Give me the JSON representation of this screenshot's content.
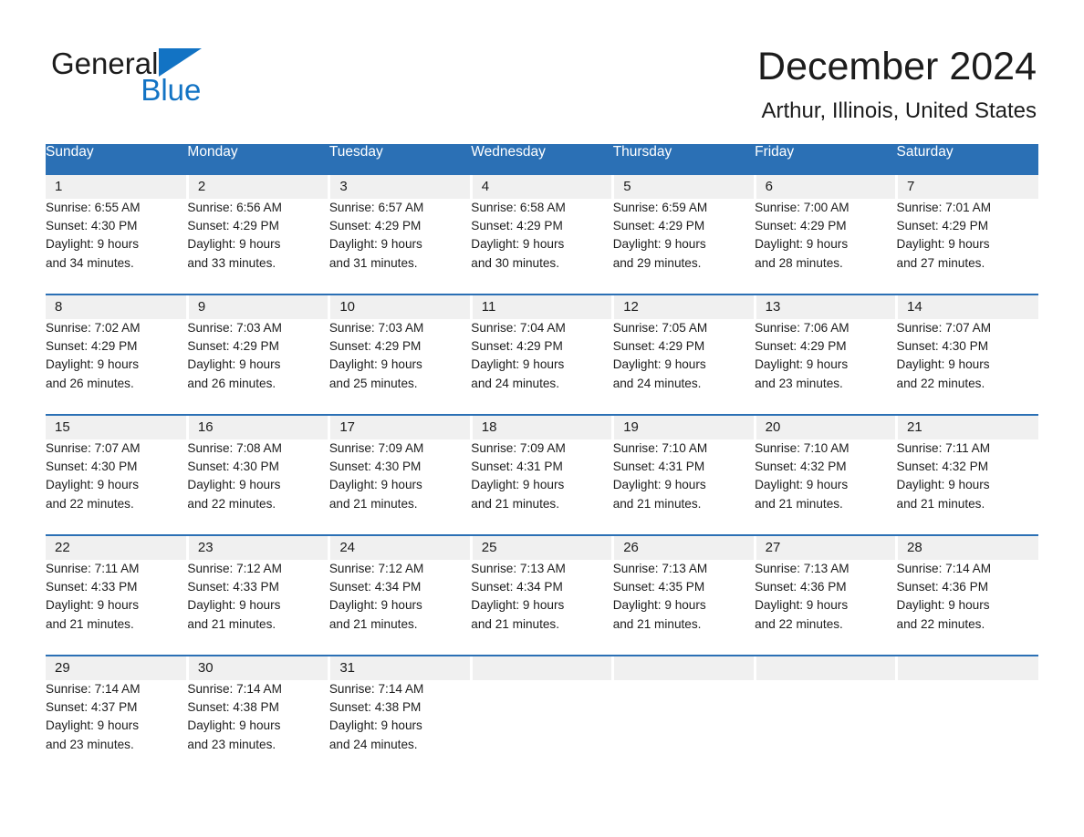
{
  "brand": {
    "name_part1": "General",
    "name_part2": "Blue",
    "triangle_color": "#1273c4",
    "text_color": "#1c1c1c"
  },
  "header": {
    "month_title": "December 2024",
    "location": "Arthur, Illinois, United States"
  },
  "theme": {
    "header_blue": "#2b70b5",
    "daynum_band": "#f0f0f0",
    "text": "#1c1c1c",
    "background": "#ffffff"
  },
  "calendar": {
    "day_headers": [
      "Sunday",
      "Monday",
      "Tuesday",
      "Wednesday",
      "Thursday",
      "Friday",
      "Saturday"
    ],
    "weeks": [
      {
        "days": [
          {
            "date": "1",
            "sunrise": "Sunrise: 6:55 AM",
            "sunset": "Sunset: 4:30 PM",
            "daylight1": "Daylight: 9 hours",
            "daylight2": "and 34 minutes."
          },
          {
            "date": "2",
            "sunrise": "Sunrise: 6:56 AM",
            "sunset": "Sunset: 4:29 PM",
            "daylight1": "Daylight: 9 hours",
            "daylight2": "and 33 minutes."
          },
          {
            "date": "3",
            "sunrise": "Sunrise: 6:57 AM",
            "sunset": "Sunset: 4:29 PM",
            "daylight1": "Daylight: 9 hours",
            "daylight2": "and 31 minutes."
          },
          {
            "date": "4",
            "sunrise": "Sunrise: 6:58 AM",
            "sunset": "Sunset: 4:29 PM",
            "daylight1": "Daylight: 9 hours",
            "daylight2": "and 30 minutes."
          },
          {
            "date": "5",
            "sunrise": "Sunrise: 6:59 AM",
            "sunset": "Sunset: 4:29 PM",
            "daylight1": "Daylight: 9 hours",
            "daylight2": "and 29 minutes."
          },
          {
            "date": "6",
            "sunrise": "Sunrise: 7:00 AM",
            "sunset": "Sunset: 4:29 PM",
            "daylight1": "Daylight: 9 hours",
            "daylight2": "and 28 minutes."
          },
          {
            "date": "7",
            "sunrise": "Sunrise: 7:01 AM",
            "sunset": "Sunset: 4:29 PM",
            "daylight1": "Daylight: 9 hours",
            "daylight2": "and 27 minutes."
          }
        ]
      },
      {
        "days": [
          {
            "date": "8",
            "sunrise": "Sunrise: 7:02 AM",
            "sunset": "Sunset: 4:29 PM",
            "daylight1": "Daylight: 9 hours",
            "daylight2": "and 26 minutes."
          },
          {
            "date": "9",
            "sunrise": "Sunrise: 7:03 AM",
            "sunset": "Sunset: 4:29 PM",
            "daylight1": "Daylight: 9 hours",
            "daylight2": "and 26 minutes."
          },
          {
            "date": "10",
            "sunrise": "Sunrise: 7:03 AM",
            "sunset": "Sunset: 4:29 PM",
            "daylight1": "Daylight: 9 hours",
            "daylight2": "and 25 minutes."
          },
          {
            "date": "11",
            "sunrise": "Sunrise: 7:04 AM",
            "sunset": "Sunset: 4:29 PM",
            "daylight1": "Daylight: 9 hours",
            "daylight2": "and 24 minutes."
          },
          {
            "date": "12",
            "sunrise": "Sunrise: 7:05 AM",
            "sunset": "Sunset: 4:29 PM",
            "daylight1": "Daylight: 9 hours",
            "daylight2": "and 24 minutes."
          },
          {
            "date": "13",
            "sunrise": "Sunrise: 7:06 AM",
            "sunset": "Sunset: 4:29 PM",
            "daylight1": "Daylight: 9 hours",
            "daylight2": "and 23 minutes."
          },
          {
            "date": "14",
            "sunrise": "Sunrise: 7:07 AM",
            "sunset": "Sunset: 4:30 PM",
            "daylight1": "Daylight: 9 hours",
            "daylight2": "and 22 minutes."
          }
        ]
      },
      {
        "days": [
          {
            "date": "15",
            "sunrise": "Sunrise: 7:07 AM",
            "sunset": "Sunset: 4:30 PM",
            "daylight1": "Daylight: 9 hours",
            "daylight2": "and 22 minutes."
          },
          {
            "date": "16",
            "sunrise": "Sunrise: 7:08 AM",
            "sunset": "Sunset: 4:30 PM",
            "daylight1": "Daylight: 9 hours",
            "daylight2": "and 22 minutes."
          },
          {
            "date": "17",
            "sunrise": "Sunrise: 7:09 AM",
            "sunset": "Sunset: 4:30 PM",
            "daylight1": "Daylight: 9 hours",
            "daylight2": "and 21 minutes."
          },
          {
            "date": "18",
            "sunrise": "Sunrise: 7:09 AM",
            "sunset": "Sunset: 4:31 PM",
            "daylight1": "Daylight: 9 hours",
            "daylight2": "and 21 minutes."
          },
          {
            "date": "19",
            "sunrise": "Sunrise: 7:10 AM",
            "sunset": "Sunset: 4:31 PM",
            "daylight1": "Daylight: 9 hours",
            "daylight2": "and 21 minutes."
          },
          {
            "date": "20",
            "sunrise": "Sunrise: 7:10 AM",
            "sunset": "Sunset: 4:32 PM",
            "daylight1": "Daylight: 9 hours",
            "daylight2": "and 21 minutes."
          },
          {
            "date": "21",
            "sunrise": "Sunrise: 7:11 AM",
            "sunset": "Sunset: 4:32 PM",
            "daylight1": "Daylight: 9 hours",
            "daylight2": "and 21 minutes."
          }
        ]
      },
      {
        "days": [
          {
            "date": "22",
            "sunrise": "Sunrise: 7:11 AM",
            "sunset": "Sunset: 4:33 PM",
            "daylight1": "Daylight: 9 hours",
            "daylight2": "and 21 minutes."
          },
          {
            "date": "23",
            "sunrise": "Sunrise: 7:12 AM",
            "sunset": "Sunset: 4:33 PM",
            "daylight1": "Daylight: 9 hours",
            "daylight2": "and 21 minutes."
          },
          {
            "date": "24",
            "sunrise": "Sunrise: 7:12 AM",
            "sunset": "Sunset: 4:34 PM",
            "daylight1": "Daylight: 9 hours",
            "daylight2": "and 21 minutes."
          },
          {
            "date": "25",
            "sunrise": "Sunrise: 7:13 AM",
            "sunset": "Sunset: 4:34 PM",
            "daylight1": "Daylight: 9 hours",
            "daylight2": "and 21 minutes."
          },
          {
            "date": "26",
            "sunrise": "Sunrise: 7:13 AM",
            "sunset": "Sunset: 4:35 PM",
            "daylight1": "Daylight: 9 hours",
            "daylight2": "and 21 minutes."
          },
          {
            "date": "27",
            "sunrise": "Sunrise: 7:13 AM",
            "sunset": "Sunset: 4:36 PM",
            "daylight1": "Daylight: 9 hours",
            "daylight2": "and 22 minutes."
          },
          {
            "date": "28",
            "sunrise": "Sunrise: 7:14 AM",
            "sunset": "Sunset: 4:36 PM",
            "daylight1": "Daylight: 9 hours",
            "daylight2": "and 22 minutes."
          }
        ]
      },
      {
        "days": [
          {
            "date": "29",
            "sunrise": "Sunrise: 7:14 AM",
            "sunset": "Sunset: 4:37 PM",
            "daylight1": "Daylight: 9 hours",
            "daylight2": "and 23 minutes."
          },
          {
            "date": "30",
            "sunrise": "Sunrise: 7:14 AM",
            "sunset": "Sunset: 4:38 PM",
            "daylight1": "Daylight: 9 hours",
            "daylight2": "and 23 minutes."
          },
          {
            "date": "31",
            "sunrise": "Sunrise: 7:14 AM",
            "sunset": "Sunset: 4:38 PM",
            "daylight1": "Daylight: 9 hours",
            "daylight2": "and 24 minutes."
          },
          {
            "date": "",
            "sunrise": "",
            "sunset": "",
            "daylight1": "",
            "daylight2": ""
          },
          {
            "date": "",
            "sunrise": "",
            "sunset": "",
            "daylight1": "",
            "daylight2": ""
          },
          {
            "date": "",
            "sunrise": "",
            "sunset": "",
            "daylight1": "",
            "daylight2": ""
          },
          {
            "date": "",
            "sunrise": "",
            "sunset": "",
            "daylight1": "",
            "daylight2": ""
          }
        ]
      }
    ]
  }
}
